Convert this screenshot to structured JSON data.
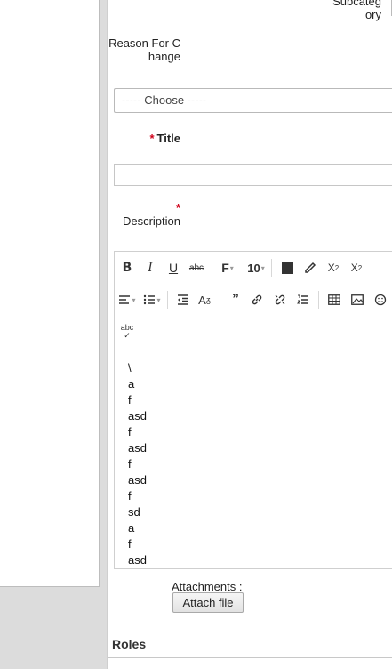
{
  "form": {
    "subcategory_label": "Subcateg ory",
    "reason_label": "Reason For Change",
    "reason_select_value": "----- Choose -----",
    "title_label": "Title",
    "title_value": "",
    "required_mark": "*",
    "description_label": "Description"
  },
  "editor": {
    "toolbar_row1": [
      "bold-icon",
      "italic-icon",
      "underline-icon",
      "strikethrough-icon",
      "font-family-icon",
      "font-size",
      "text-color-icon",
      "highlight-icon",
      "subscript-icon",
      "superscript-icon"
    ],
    "font_size_value": "10",
    "toolbar_row2": [
      "align-icon",
      "bulleted-list-icon",
      "outdent-icon",
      "clear-format-icon",
      "blockquote-icon",
      "link-icon",
      "unlink-icon",
      "numbered-list-icon",
      "table-icon",
      "image-icon",
      "emoji-icon"
    ],
    "toolbar_row3": [
      "spellcheck-icon"
    ],
    "content_lines": [
      "\\",
      "a",
      "f",
      "asd",
      "f",
      "asd",
      "f",
      "asd",
      "f",
      "sd",
      "a",
      "f",
      "asd"
    ]
  },
  "attachments": {
    "label": "Attachments :",
    "button_label": "Attach file"
  },
  "roles": {
    "heading": "Roles"
  }
}
